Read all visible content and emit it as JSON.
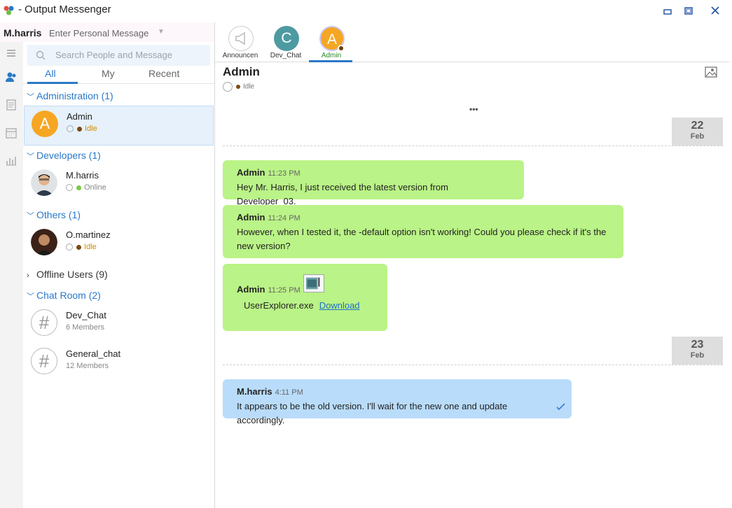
{
  "window": {
    "title": "- Output Messenger"
  },
  "user": {
    "name": "M.harris",
    "personal_message_placeholder": "Enter Personal Message"
  },
  "search": {
    "placeholder": "Search People and Message"
  },
  "tabs": [
    {
      "label": "All"
    },
    {
      "label": "My"
    },
    {
      "label": "Recent"
    }
  ],
  "groups": {
    "administration": "Administration (1)",
    "developers": "Developers (1)",
    "others": "Others (1)",
    "offline": "Offline Users (9)",
    "chatroom": "Chat Room (2)"
  },
  "contacts": [
    {
      "name": "Admin",
      "status": "Idle",
      "initial": "A"
    },
    {
      "name": "M.harris",
      "status": "Online"
    },
    {
      "name": "O.martinez",
      "status": "Idle"
    }
  ],
  "rooms": [
    {
      "name": "Dev_Chat",
      "members": "6 Members"
    },
    {
      "name": "General_chat",
      "members": "12 Members"
    }
  ],
  "chat_tabs": [
    {
      "label": "Announcen"
    },
    {
      "label": "Dev_Chat",
      "initial": "C"
    },
    {
      "label": "Admin",
      "initial": "A"
    }
  ],
  "chat": {
    "name": "Admin",
    "status": "Idle",
    "more": "•••",
    "dates": [
      {
        "day": "22",
        "month": "Feb"
      },
      {
        "day": "23",
        "month": "Feb"
      }
    ],
    "messages": [
      {
        "sender": "Admin",
        "time": "11:23 PM",
        "text": "Hey Mr. Harris, I just received the latest version from Developer_03."
      },
      {
        "sender": "Admin",
        "time": "11:24 PM",
        "text": "However, when I tested it, the -default option isn't working! Could you please check if it's the new version?"
      },
      {
        "sender": "Admin",
        "time": "11:25 PM",
        "file": "UserExplorer.exe",
        "download": "Download"
      },
      {
        "sender": "M.harris",
        "time": "4:11 PM",
        "text": "It appears to be the old version. I'll wait for the new one and update accordingly."
      }
    ]
  },
  "colors": {
    "accent": "#2a79c9",
    "incoming_bubble": "#baf387",
    "outgoing_bubble": "#b9dcfb",
    "idle": "#7a4a10",
    "online": "#7ac943"
  }
}
